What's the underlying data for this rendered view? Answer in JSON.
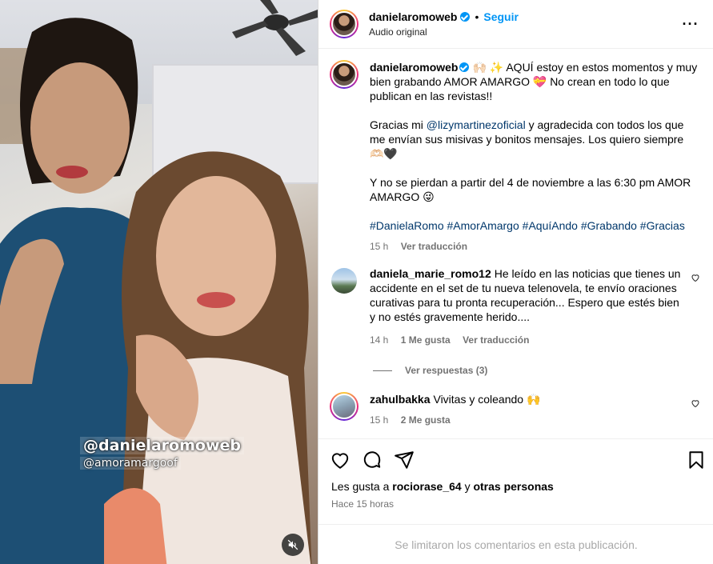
{
  "media": {
    "overlay_tag_1": "@danielaromoweb",
    "overlay_tag_2": "@amoramargoof",
    "mute_icon": "speaker-muted-icon"
  },
  "header": {
    "username": "danielaromoweb",
    "separator": "•",
    "follow_label": "Seguir",
    "subtitle": "Audio original",
    "more_icon": "more-options-icon"
  },
  "caption": {
    "username": "danielaromoweb",
    "para1": "🙌🏻 ✨ AQUÍ estoy en estos momentos y muy bien grabando AMOR AMARGO 💝 No crean en todo lo que publican en las revistas!!",
    "para2_prefix": "Gracias mi ",
    "para2_mention": "@lizymartinezoficial",
    "para2_suffix": " y agradecida con todos los que me envían sus misivas y bonitos mensajes. Los quiero siempre 🫶🏻🖤",
    "para3": "Y no se pierdan a partir del 4 de noviembre a las 6:30 pm AMOR AMARGO 😜",
    "hashtags": [
      "#DanielaRomo",
      "#AmorAmargo",
      "#AquíAndo",
      "#Grabando",
      "#Gracias"
    ],
    "time": "15 h",
    "translate": "Ver traducción"
  },
  "comments": [
    {
      "username": "daniela_marie_romo12",
      "text": "He leído en las noticias que tienes un accidente en el set de tu nueva telenovela, te envío oraciones curativas para tu pronta recuperación... Espero que estés bien y no estés gravemente herido....",
      "time": "14 h",
      "likes": "1 Me gusta",
      "translate": "Ver traducción",
      "replies": "Ver respuestas (3)"
    },
    {
      "username": "zahulbakka",
      "text": "Vivitas y coleando 🙌",
      "time": "15 h",
      "likes": "2 Me gusta"
    }
  ],
  "footer": {
    "likes_prefix": "Les gusta a ",
    "likes_user": "rociorase_64",
    "likes_and": " y ",
    "likes_others": "otras personas",
    "posted": "Hace 15 horas",
    "limited": "Se limitaron los comentarios en esta publicación."
  },
  "colors": {
    "accent": "#0095f6",
    "link": "#00376b",
    "muted": "#737373"
  }
}
